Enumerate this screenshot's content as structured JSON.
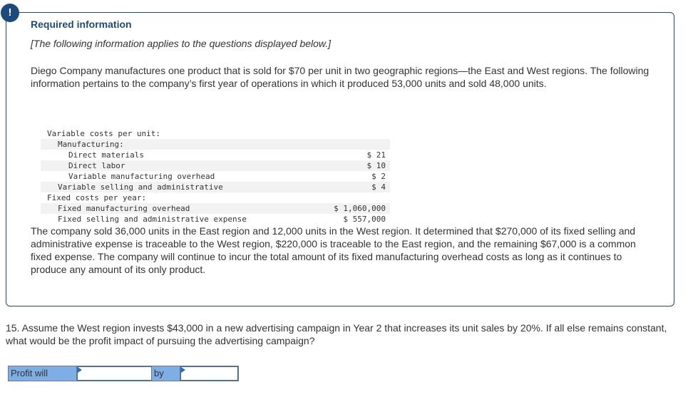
{
  "alert": {
    "icon": "exclamation-icon",
    "symbol": "!"
  },
  "info": {
    "title": "Required information",
    "subtitle": "[The following information applies to the questions displayed below.]",
    "paragraph1": "Diego Company manufactures one product that is sold for $70 per unit in two geographic regions—the East and West regions. The following information pertains to the company’s first year of operations in which it produced 53,000 units and sold 48,000 units.",
    "paragraph2": "The company sold 36,000 units in the East region and 12,000 units in the West region. It determined that $270,000 of its fixed selling and administrative expense is traceable to the West region, $220,000 is traceable to the East region, and the remaining $67,000 is a common fixed expense. The company will continue to incur the total amount of its fixed manufacturing overhead costs as long as it continues to produce any amount of its only product."
  },
  "cost_table": {
    "rows": [
      {
        "label": "Variable costs per unit:",
        "value": ""
      },
      {
        "label": "Manufacturing:",
        "value": ""
      },
      {
        "label": "Direct materials",
        "value": "$ 21"
      },
      {
        "label": "Direct labor",
        "value": "$ 10"
      },
      {
        "label": "Variable manufacturing overhead",
        "value": "$ 2"
      },
      {
        "label": "Variable selling and administrative",
        "value": "$ 4"
      },
      {
        "label": "Fixed costs per year:",
        "value": ""
      },
      {
        "label": "Fixed manufacturing overhead",
        "value": "$ 1,060,000"
      },
      {
        "label": "Fixed selling and administrative expense",
        "value": "$ 557,000"
      }
    ]
  },
  "question": {
    "text": "15. Assume the West region invests $43,000 in a new advertising campaign in Year 2 that increases its unit sales by 20%. If all else remains constant, what would be the profit impact of pursuing the advertising campaign?"
  },
  "answer": {
    "label1": "Profit will",
    "direction_value": "",
    "label2": "by",
    "amount_value": ""
  }
}
